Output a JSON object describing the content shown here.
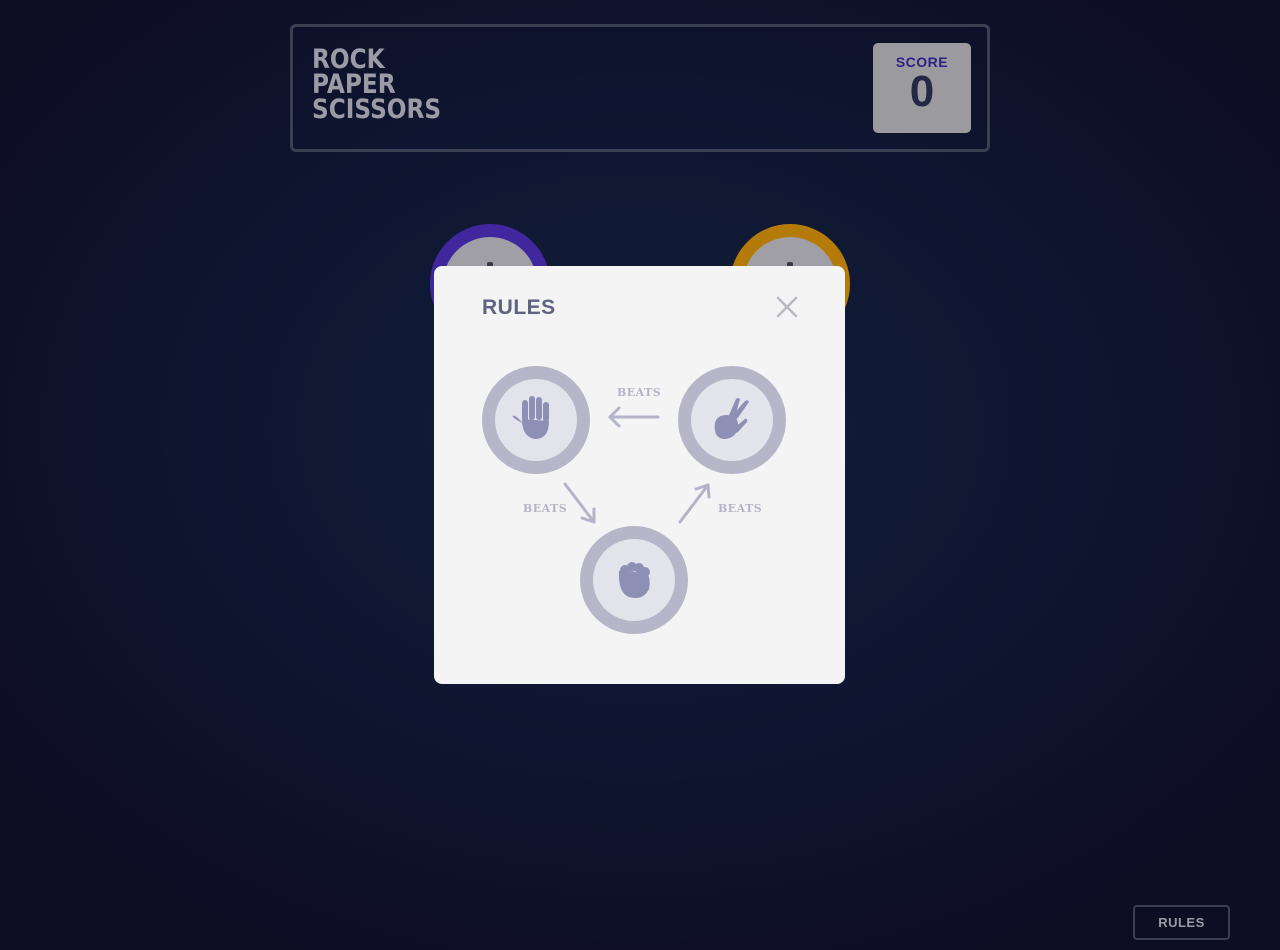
{
  "header": {
    "title_lines": [
      "ROCK",
      "PAPER",
      "SCISSORS"
    ],
    "score_label": "SCORE",
    "score_value": "0"
  },
  "board": {
    "tokens": [
      {
        "name": "paper",
        "color": "#40279e"
      },
      {
        "name": "scissors",
        "color": "#b47b0b"
      }
    ]
  },
  "modal": {
    "title": "RULES",
    "close_icon": "close-icon",
    "beats_labels": [
      "BEATS",
      "BEATS",
      "BEATS"
    ],
    "choices": [
      {
        "name": "paper",
        "icon": "paper-hand-icon"
      },
      {
        "name": "scissors",
        "icon": "scissors-hand-icon"
      },
      {
        "name": "rock",
        "icon": "rock-fist-icon"
      }
    ]
  },
  "footer": {
    "rules_button_label": "RULES"
  },
  "colors": {
    "score_label": "#2d1f83",
    "modal_bg": "#f4f4f4",
    "icon_fill": "#8e8fb5"
  }
}
